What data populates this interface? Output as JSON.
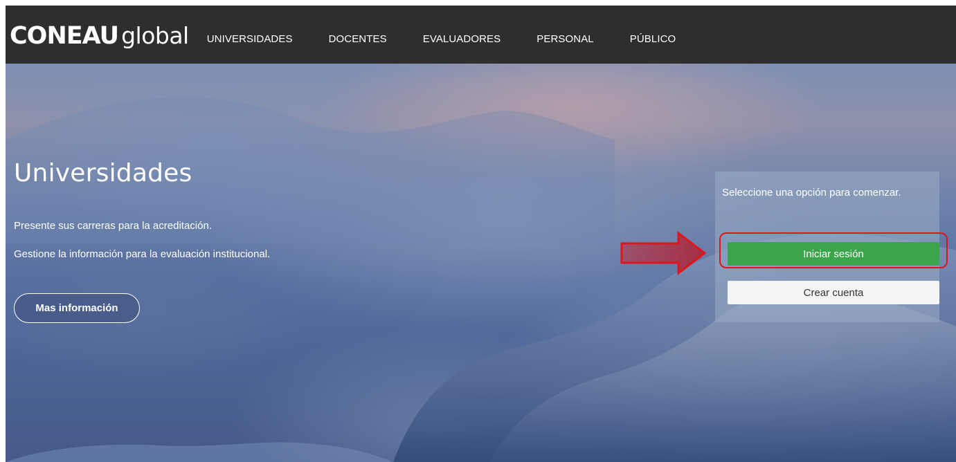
{
  "brand": {
    "logo_bold": "CONEAU",
    "logo_light": "global"
  },
  "nav": {
    "items": [
      {
        "label": "UNIVERSIDADES"
      },
      {
        "label": "DOCENTES"
      },
      {
        "label": "EVALUADORES"
      },
      {
        "label": "PERSONAL"
      },
      {
        "label": "PÚBLICO"
      }
    ]
  },
  "hero": {
    "title": "Universidades",
    "line1": "Presente sus carreras para la acreditación.",
    "line2": "Gestione la información para la evaluación institucional.",
    "more_button": "Mas información"
  },
  "panel": {
    "prompt": "Seleccione una opción para comenzar.",
    "login_button": "Iniciar sesión",
    "create_button": "Crear cuenta"
  },
  "colors": {
    "navbar": "#2e2e2e",
    "login_green": "#3aa54a",
    "annotation_red": "#e0141c"
  },
  "icons": {
    "annotation_arrow": "arrow-right-icon"
  }
}
